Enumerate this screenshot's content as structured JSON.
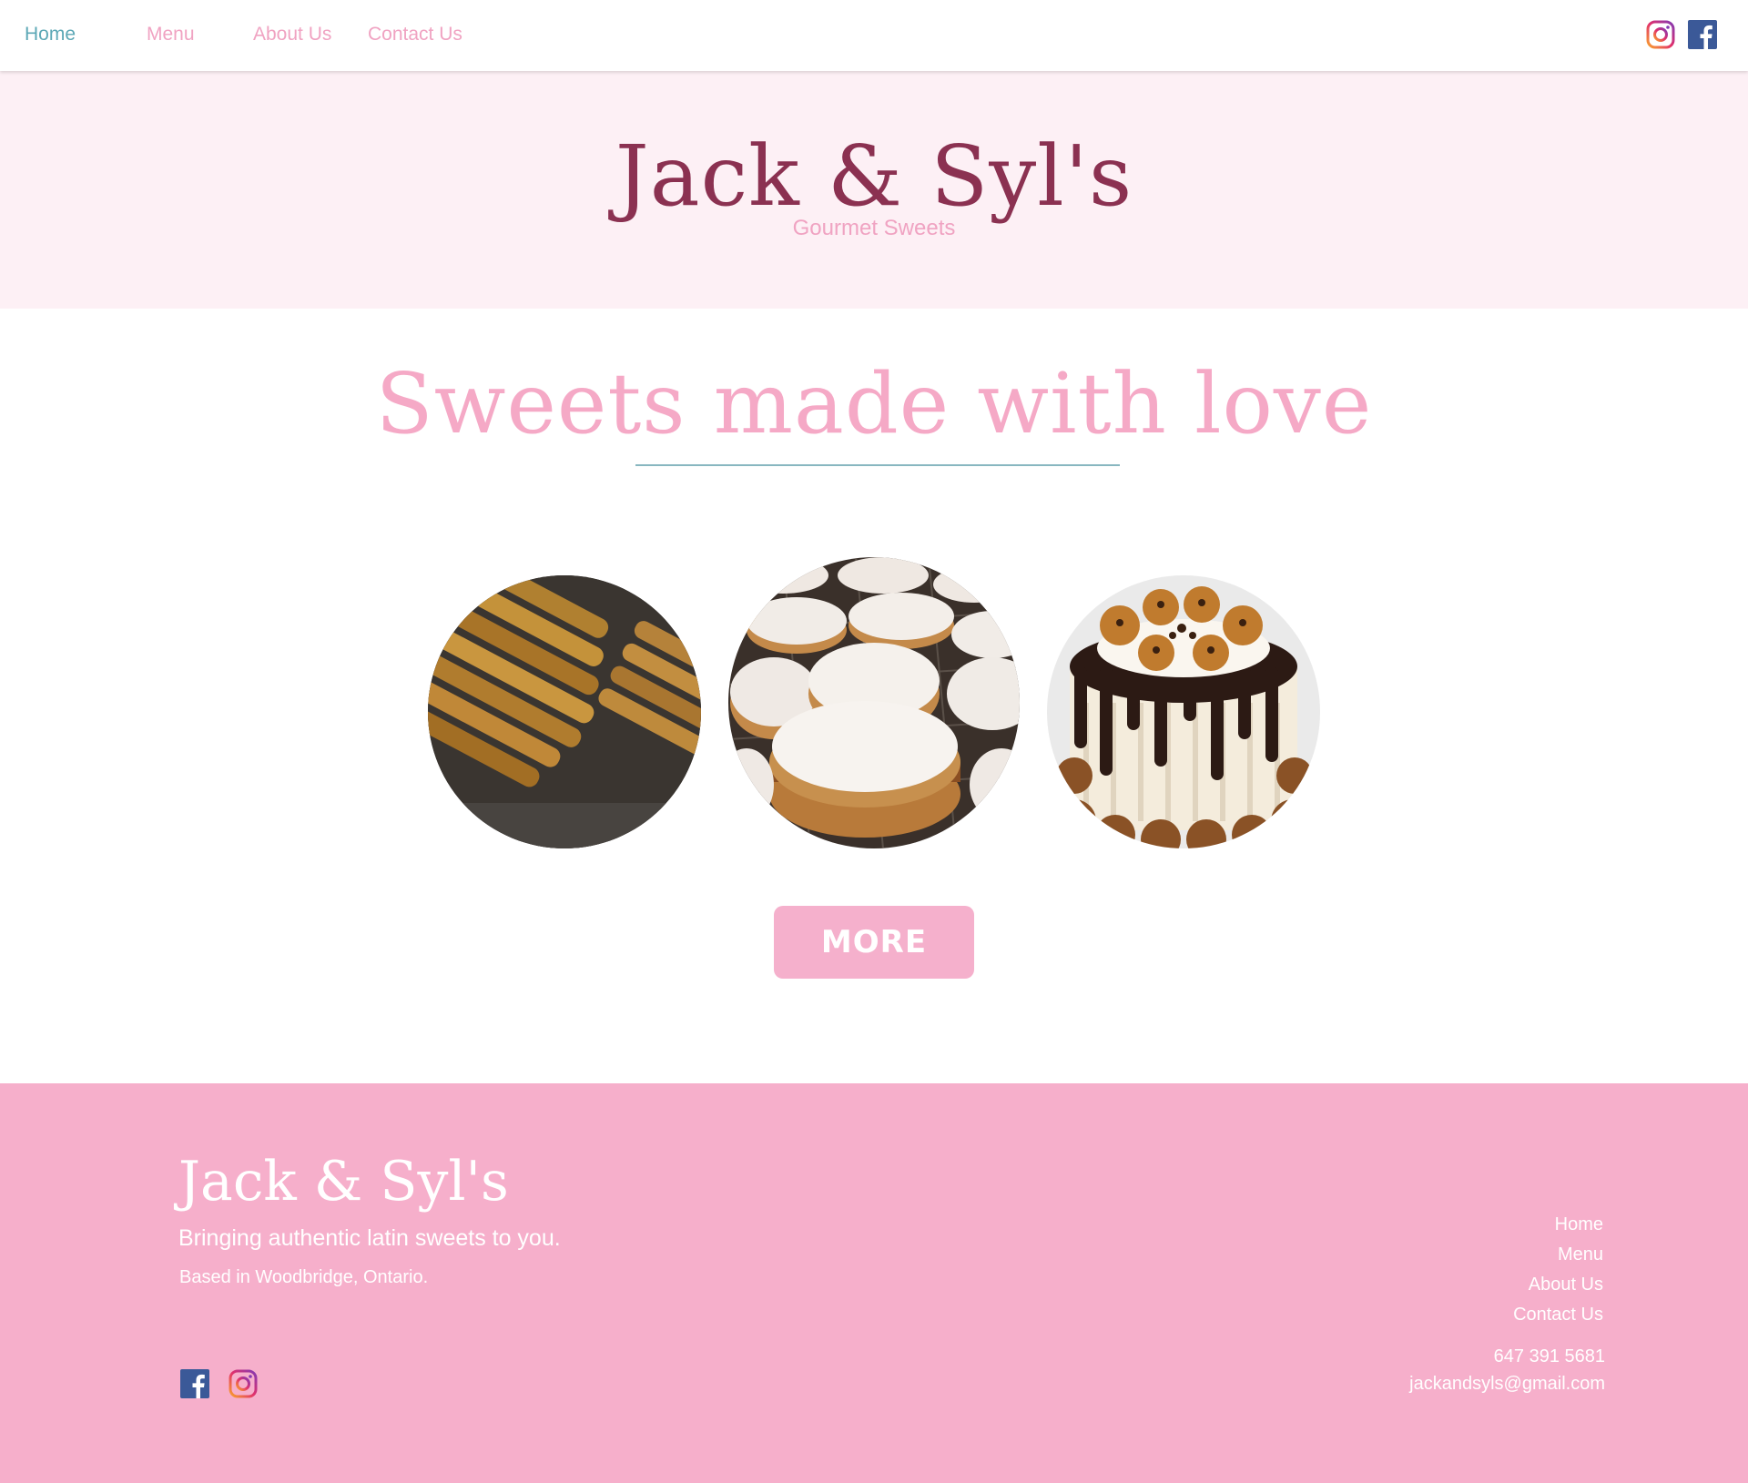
{
  "nav": {
    "items": [
      {
        "label": "Home",
        "active": true
      },
      {
        "label": "Menu",
        "active": false
      },
      {
        "label": "About Us",
        "active": false
      },
      {
        "label": "Contact Us",
        "active": false
      }
    ],
    "social": [
      "instagram-icon",
      "facebook-icon"
    ]
  },
  "hero": {
    "title": "Jack & Syl's",
    "subtitle": "Gourmet Sweets"
  },
  "main": {
    "headline": "Sweets made with love",
    "photos": [
      "churros",
      "alfajores",
      "drip-cake"
    ],
    "more_label": "MORE"
  },
  "footer": {
    "brand": "Jack & Syl's",
    "tagline": "Bringing authentic latin sweets to you.",
    "location": "Based in Woodbridge, Ontario.",
    "links": [
      "Home",
      "Menu",
      "About Us",
      "Contact Us"
    ],
    "phone": "647 391 5681",
    "email": "jackandsyls@gmail.com",
    "social": [
      "facebook-icon",
      "instagram-icon"
    ]
  },
  "colors": {
    "accent_pink": "#f5b0cc",
    "brand_maroon": "#8b3151",
    "nav_active": "#5ca8b6",
    "hero_bg": "#fdf0f5",
    "footer_bg": "#f6afcb"
  }
}
